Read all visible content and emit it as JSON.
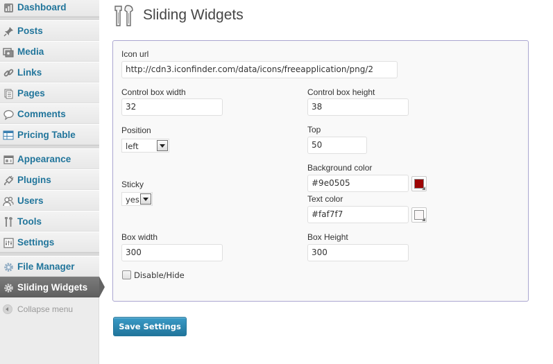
{
  "sidebar": {
    "items": [
      {
        "label": "Dashboard",
        "icon": "dashboard-icon"
      },
      {
        "label": "Posts",
        "icon": "pushpin-icon"
      },
      {
        "label": "Media",
        "icon": "media-icon"
      },
      {
        "label": "Links",
        "icon": "link-icon"
      },
      {
        "label": "Pages",
        "icon": "pages-icon"
      },
      {
        "label": "Comments",
        "icon": "comment-bubble-icon"
      },
      {
        "label": "Pricing Table",
        "icon": "table-icon"
      },
      {
        "label": "Appearance",
        "icon": "appearance-icon"
      },
      {
        "label": "Plugins",
        "icon": "plug-icon"
      },
      {
        "label": "Users",
        "icon": "users-icon"
      },
      {
        "label": "Tools",
        "icon": "tools-icon"
      },
      {
        "label": "Settings",
        "icon": "settings-icon"
      },
      {
        "label": "File Manager",
        "icon": "gear-icon"
      },
      {
        "label": "Sliding Widgets",
        "icon": "gear-icon"
      }
    ],
    "current": "Sliding Widgets",
    "collapse_label": "Collapse menu"
  },
  "header": {
    "title": "Sliding Widgets",
    "icon": "tools-icon"
  },
  "form": {
    "icon_url": {
      "label": "Icon url",
      "value": "http://cdn3.iconfinder.com/data/icons/freeapplication/png/2"
    },
    "control_box_width": {
      "label": "Control box width",
      "value": "32"
    },
    "control_box_height": {
      "label": "Control box height",
      "value": "38"
    },
    "position": {
      "label": "Position",
      "value": "left"
    },
    "top": {
      "label": "Top",
      "value": "50"
    },
    "background_color": {
      "label": "Background color",
      "value": "#9e0505",
      "swatch": "#9e0505"
    },
    "sticky": {
      "label": "Sticky",
      "value": "yes"
    },
    "text_color": {
      "label": "Text color",
      "value": "#faf7f7",
      "swatch": "#faf7f7"
    },
    "box_width": {
      "label": "Box width",
      "value": "300"
    },
    "box_height": {
      "label": "Box Height",
      "value": "300"
    },
    "disable_hide": {
      "label": "Disable/Hide",
      "checked": false
    }
  },
  "save_button": {
    "label": "Save Settings"
  },
  "colors": {
    "link": "#21759b",
    "current_menu_bg": "#6d6d6d",
    "box_border": "#aaa6d0",
    "button": "#21759b"
  }
}
